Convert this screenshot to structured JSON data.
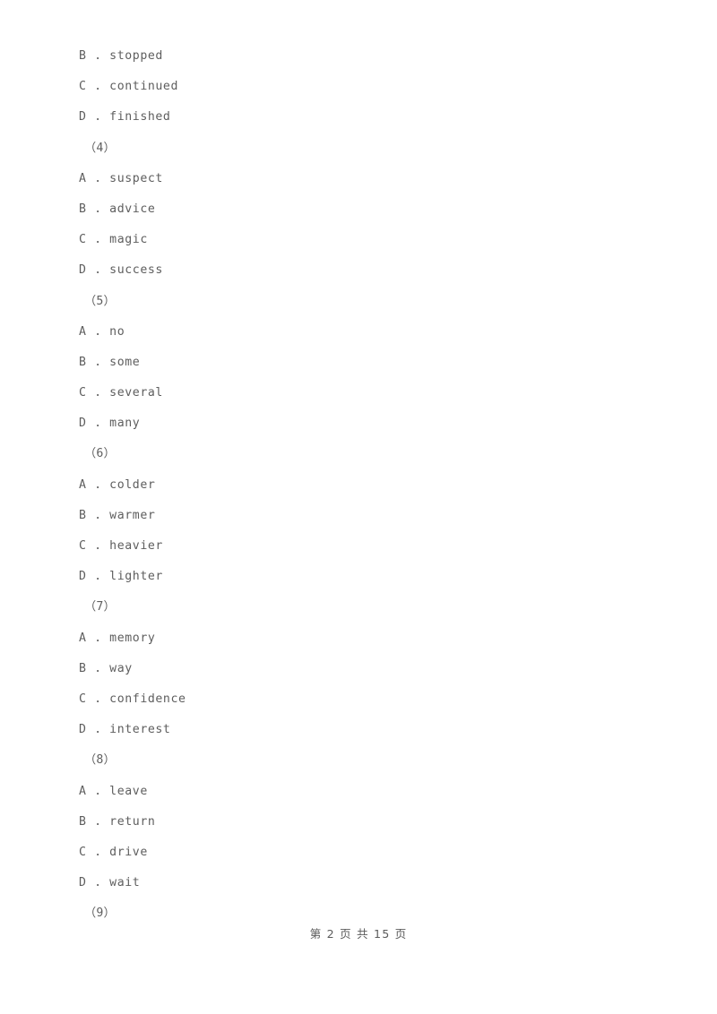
{
  "document": {
    "background_color": "#ffffff",
    "text_color": "#5e5e5e",
    "blocks": [
      {
        "type": "option",
        "text": "B . stopped"
      },
      {
        "type": "option",
        "text": "C . continued"
      },
      {
        "type": "option",
        "text": "D . finished"
      },
      {
        "type": "question_number",
        "text": "（4）"
      },
      {
        "type": "option",
        "text": "A . suspect"
      },
      {
        "type": "option",
        "text": "B . advice"
      },
      {
        "type": "option",
        "text": "C . magic"
      },
      {
        "type": "option",
        "text": "D . success"
      },
      {
        "type": "question_number",
        "text": "（5）"
      },
      {
        "type": "option",
        "text": "A . no"
      },
      {
        "type": "option",
        "text": "B . some"
      },
      {
        "type": "option",
        "text": "C . several"
      },
      {
        "type": "option",
        "text": "D . many"
      },
      {
        "type": "question_number",
        "text": "（6）"
      },
      {
        "type": "option",
        "text": "A . colder"
      },
      {
        "type": "option",
        "text": "B . warmer"
      },
      {
        "type": "option",
        "text": "C . heavier"
      },
      {
        "type": "option",
        "text": "D . lighter"
      },
      {
        "type": "question_number",
        "text": "（7）"
      },
      {
        "type": "option",
        "text": "A . memory"
      },
      {
        "type": "option",
        "text": "B . way"
      },
      {
        "type": "option",
        "text": "C . confidence"
      },
      {
        "type": "option",
        "text": "D . interest"
      },
      {
        "type": "question_number",
        "text": "（8）"
      },
      {
        "type": "option",
        "text": "A . leave"
      },
      {
        "type": "option",
        "text": "B . return"
      },
      {
        "type": "option",
        "text": "C . drive"
      },
      {
        "type": "option",
        "text": "D . wait"
      },
      {
        "type": "question_number",
        "text": "（9）"
      }
    ]
  },
  "footer": {
    "page_label": "第 2 页 共 15 页",
    "current_page": 2,
    "total_pages": 15
  }
}
